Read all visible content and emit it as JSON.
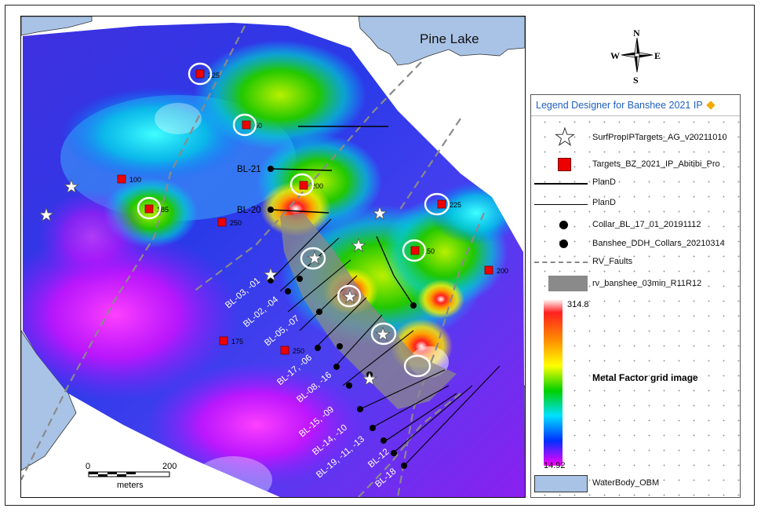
{
  "map": {
    "lake_name": "Pine Lake",
    "drillholes": [
      "BL-21",
      "BL-20",
      "BL-03, -01",
      "BL-02, -04",
      "BL-05, -07",
      "BL-17, -06",
      "BL-08, -16",
      "BL-15, -09",
      "BL-14, -10",
      "BL-19, -11, -13",
      "BL-12",
      "BL-18"
    ],
    "target_values": [
      "225",
      "50",
      "100",
      "185",
      "200",
      "250",
      "225",
      "150",
      "200",
      "175",
      "250"
    ],
    "scale_bar": {
      "min_label": "0",
      "max_label": "200",
      "unit": "meters"
    }
  },
  "compass": {
    "n": "N",
    "s": "S",
    "e": "E",
    "w": "W"
  },
  "legend": {
    "header": "Legend Designer for Banshee 2021 IP",
    "items": [
      {
        "label": "SurfPropIPTargets_AG_v20211010",
        "icon": "star-icon"
      },
      {
        "label": "Targets_BZ_2021_IP_Abitibi_Pro",
        "icon": "red-square-icon"
      },
      {
        "label": "PlanD",
        "icon": "thick-line-icon"
      },
      {
        "label": "PlanD",
        "icon": "thin-line-icon"
      },
      {
        "label": "Collar_BL_17_01_20191112",
        "icon": "black-dot-icon"
      },
      {
        "label": "Banshee_DDH_Collars_20210314",
        "icon": "black-dot-icon"
      },
      {
        "label": "RV_Faults",
        "icon": "dashed-line-icon"
      },
      {
        "label": "rv_banshee_03min_R11R12",
        "icon": "gray-rect-icon"
      }
    ],
    "colorbar": {
      "max": "314.8",
      "min": "14.92",
      "title": "Metal Factor grid image"
    },
    "waterbody": "WaterBody_OBM"
  },
  "colors": {
    "water": "#a9c3e6",
    "target": "#ee0000",
    "legend_header_text": "#1f5fbf"
  }
}
